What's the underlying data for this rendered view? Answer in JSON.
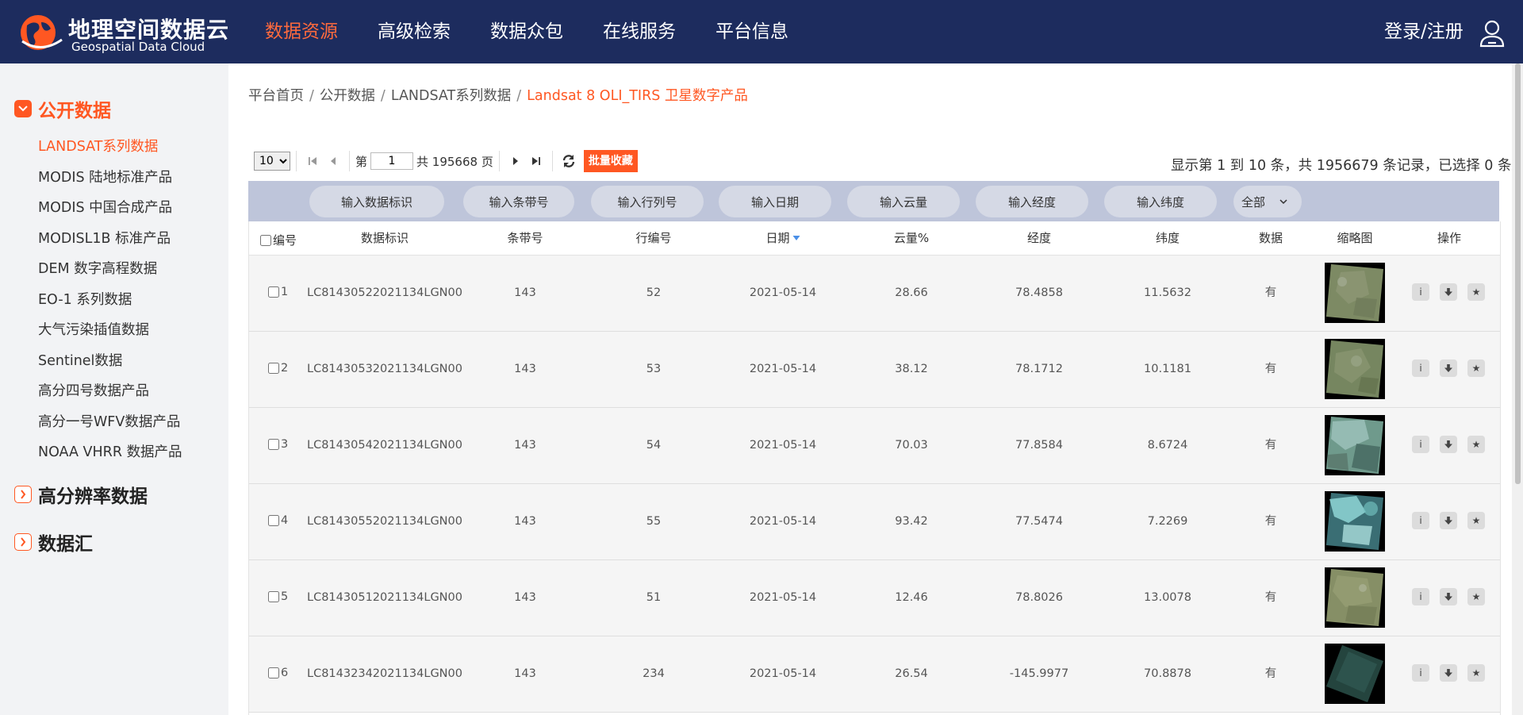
{
  "header": {
    "logo_cn": "地理空间数据云",
    "logo_en": "Geospatial Data Cloud",
    "nav": [
      {
        "label": "数据资源",
        "active": true
      },
      {
        "label": "高级检索",
        "active": false
      },
      {
        "label": "数据众包",
        "active": false
      },
      {
        "label": "在线服务",
        "active": false
      },
      {
        "label": "平台信息",
        "active": false
      }
    ],
    "login_label": "登录/注册",
    "brand_color": "#1d2c5e",
    "accent_color": "#ff5722"
  },
  "sidebar": {
    "categories": [
      {
        "label": "公开数据",
        "expanded": true
      },
      {
        "label": "高分辨率数据",
        "expanded": false
      },
      {
        "label": "数据汇",
        "expanded": false
      }
    ],
    "items": [
      {
        "label": "LANDSAT系列数据",
        "active": true
      },
      {
        "label": "MODIS 陆地标准产品",
        "active": false
      },
      {
        "label": "MODIS 中国合成产品",
        "active": false
      },
      {
        "label": "MODISL1B 标准产品",
        "active": false
      },
      {
        "label": "DEM 数字高程数据",
        "active": false
      },
      {
        "label": "EO-1 系列数据",
        "active": false
      },
      {
        "label": "大气污染插值数据",
        "active": false
      },
      {
        "label": "Sentinel数据",
        "active": false
      },
      {
        "label": "高分四号数据产品",
        "active": false
      },
      {
        "label": "高分一号WFV数据产品",
        "active": false
      },
      {
        "label": "NOAA VHRR 数据产品",
        "active": false
      }
    ]
  },
  "breadcrumb": [
    "平台首页",
    "公开数据",
    "LANDSAT系列数据",
    "Landsat 8 OLI_TIRS 卫星数字产品"
  ],
  "pager": {
    "page_size": "10",
    "page_prefix": "第",
    "current_page": "1",
    "total_pages_text": "共 195668 页",
    "batch_label": "批量收藏"
  },
  "record_info": "显示第 1 到 10 条，共 1956679 条记录，已选择 0 条",
  "filters": {
    "placeholders": [
      "输入数据标识",
      "输入条带号",
      "输入行列号",
      "输入日期",
      "输入云量",
      "输入经度",
      "输入纬度"
    ],
    "select_value": "全部"
  },
  "table": {
    "headers": [
      "编号",
      "数据标识",
      "条带号",
      "行编号",
      "日期",
      "云量%",
      "经度",
      "纬度",
      "数据",
      "缩略图",
      "操作"
    ],
    "rows": [
      {
        "no": "1",
        "id": "LC81430522021134LGN00",
        "path": "143",
        "row": "52",
        "date": "2021-05-14",
        "cloud": "28.66",
        "lon": "78.4858",
        "lat": "11.5632",
        "has_data": "有",
        "thumb": "greenish"
      },
      {
        "no": "2",
        "id": "LC81430532021134LGN00",
        "path": "143",
        "row": "53",
        "date": "2021-05-14",
        "cloud": "38.12",
        "lon": "78.1712",
        "lat": "10.1181",
        "has_data": "有",
        "thumb": "greenish"
      },
      {
        "no": "3",
        "id": "LC81430542021134LGN00",
        "path": "143",
        "row": "54",
        "date": "2021-05-14",
        "cloud": "70.03",
        "lon": "77.8584",
        "lat": "8.6724",
        "has_data": "有",
        "thumb": "cloudy-sea"
      },
      {
        "no": "4",
        "id": "LC81430552021134LGN00",
        "path": "143",
        "row": "55",
        "date": "2021-05-14",
        "cloud": "93.42",
        "lon": "77.5474",
        "lat": "7.2269",
        "has_data": "有",
        "thumb": "cloudy"
      },
      {
        "no": "5",
        "id": "LC81430512021134LGN00",
        "path": "143",
        "row": "51",
        "date": "2021-05-14",
        "cloud": "12.46",
        "lon": "78.8026",
        "lat": "13.0078",
        "has_data": "有",
        "thumb": "greenish"
      },
      {
        "no": "6",
        "id": "LC81432342021134LGN00",
        "path": "143",
        "row": "234",
        "date": "2021-05-14",
        "cloud": "26.54",
        "lon": "-145.9977",
        "lat": "70.8878",
        "has_data": "有",
        "thumb": "dark"
      }
    ]
  }
}
